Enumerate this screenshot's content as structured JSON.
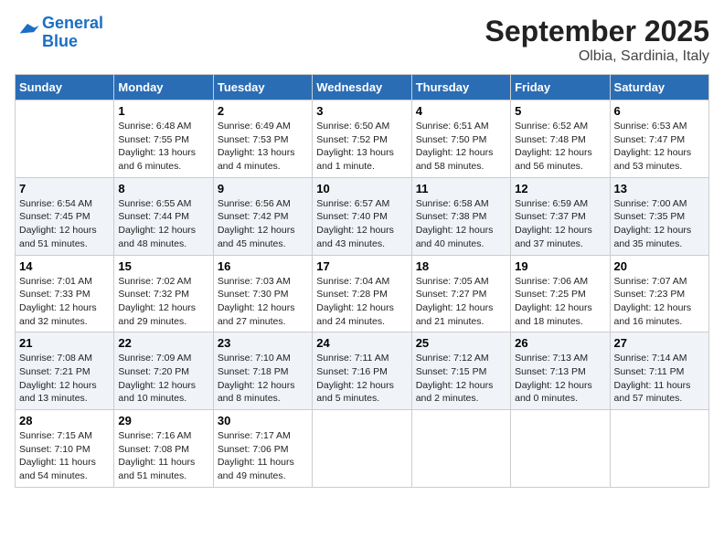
{
  "logo": {
    "line1": "General",
    "line2": "Blue"
  },
  "title": "September 2025",
  "subtitle": "Olbia, Sardinia, Italy",
  "headers": [
    "Sunday",
    "Monday",
    "Tuesday",
    "Wednesday",
    "Thursday",
    "Friday",
    "Saturday"
  ],
  "weeks": [
    [
      {
        "day": "",
        "info": ""
      },
      {
        "day": "1",
        "info": "Sunrise: 6:48 AM\nSunset: 7:55 PM\nDaylight: 13 hours\nand 6 minutes."
      },
      {
        "day": "2",
        "info": "Sunrise: 6:49 AM\nSunset: 7:53 PM\nDaylight: 13 hours\nand 4 minutes."
      },
      {
        "day": "3",
        "info": "Sunrise: 6:50 AM\nSunset: 7:52 PM\nDaylight: 13 hours\nand 1 minute."
      },
      {
        "day": "4",
        "info": "Sunrise: 6:51 AM\nSunset: 7:50 PM\nDaylight: 12 hours\nand 58 minutes."
      },
      {
        "day": "5",
        "info": "Sunrise: 6:52 AM\nSunset: 7:48 PM\nDaylight: 12 hours\nand 56 minutes."
      },
      {
        "day": "6",
        "info": "Sunrise: 6:53 AM\nSunset: 7:47 PM\nDaylight: 12 hours\nand 53 minutes."
      }
    ],
    [
      {
        "day": "7",
        "info": "Sunrise: 6:54 AM\nSunset: 7:45 PM\nDaylight: 12 hours\nand 51 minutes."
      },
      {
        "day": "8",
        "info": "Sunrise: 6:55 AM\nSunset: 7:44 PM\nDaylight: 12 hours\nand 48 minutes."
      },
      {
        "day": "9",
        "info": "Sunrise: 6:56 AM\nSunset: 7:42 PM\nDaylight: 12 hours\nand 45 minutes."
      },
      {
        "day": "10",
        "info": "Sunrise: 6:57 AM\nSunset: 7:40 PM\nDaylight: 12 hours\nand 43 minutes."
      },
      {
        "day": "11",
        "info": "Sunrise: 6:58 AM\nSunset: 7:38 PM\nDaylight: 12 hours\nand 40 minutes."
      },
      {
        "day": "12",
        "info": "Sunrise: 6:59 AM\nSunset: 7:37 PM\nDaylight: 12 hours\nand 37 minutes."
      },
      {
        "day": "13",
        "info": "Sunrise: 7:00 AM\nSunset: 7:35 PM\nDaylight: 12 hours\nand 35 minutes."
      }
    ],
    [
      {
        "day": "14",
        "info": "Sunrise: 7:01 AM\nSunset: 7:33 PM\nDaylight: 12 hours\nand 32 minutes."
      },
      {
        "day": "15",
        "info": "Sunrise: 7:02 AM\nSunset: 7:32 PM\nDaylight: 12 hours\nand 29 minutes."
      },
      {
        "day": "16",
        "info": "Sunrise: 7:03 AM\nSunset: 7:30 PM\nDaylight: 12 hours\nand 27 minutes."
      },
      {
        "day": "17",
        "info": "Sunrise: 7:04 AM\nSunset: 7:28 PM\nDaylight: 12 hours\nand 24 minutes."
      },
      {
        "day": "18",
        "info": "Sunrise: 7:05 AM\nSunset: 7:27 PM\nDaylight: 12 hours\nand 21 minutes."
      },
      {
        "day": "19",
        "info": "Sunrise: 7:06 AM\nSunset: 7:25 PM\nDaylight: 12 hours\nand 18 minutes."
      },
      {
        "day": "20",
        "info": "Sunrise: 7:07 AM\nSunset: 7:23 PM\nDaylight: 12 hours\nand 16 minutes."
      }
    ],
    [
      {
        "day": "21",
        "info": "Sunrise: 7:08 AM\nSunset: 7:21 PM\nDaylight: 12 hours\nand 13 minutes."
      },
      {
        "day": "22",
        "info": "Sunrise: 7:09 AM\nSunset: 7:20 PM\nDaylight: 12 hours\nand 10 minutes."
      },
      {
        "day": "23",
        "info": "Sunrise: 7:10 AM\nSunset: 7:18 PM\nDaylight: 12 hours\nand 8 minutes."
      },
      {
        "day": "24",
        "info": "Sunrise: 7:11 AM\nSunset: 7:16 PM\nDaylight: 12 hours\nand 5 minutes."
      },
      {
        "day": "25",
        "info": "Sunrise: 7:12 AM\nSunset: 7:15 PM\nDaylight: 12 hours\nand 2 minutes."
      },
      {
        "day": "26",
        "info": "Sunrise: 7:13 AM\nSunset: 7:13 PM\nDaylight: 12 hours\nand 0 minutes."
      },
      {
        "day": "27",
        "info": "Sunrise: 7:14 AM\nSunset: 7:11 PM\nDaylight: 11 hours\nand 57 minutes."
      }
    ],
    [
      {
        "day": "28",
        "info": "Sunrise: 7:15 AM\nSunset: 7:10 PM\nDaylight: 11 hours\nand 54 minutes."
      },
      {
        "day": "29",
        "info": "Sunrise: 7:16 AM\nSunset: 7:08 PM\nDaylight: 11 hours\nand 51 minutes."
      },
      {
        "day": "30",
        "info": "Sunrise: 7:17 AM\nSunset: 7:06 PM\nDaylight: 11 hours\nand 49 minutes."
      },
      {
        "day": "",
        "info": ""
      },
      {
        "day": "",
        "info": ""
      },
      {
        "day": "",
        "info": ""
      },
      {
        "day": "",
        "info": ""
      }
    ]
  ]
}
